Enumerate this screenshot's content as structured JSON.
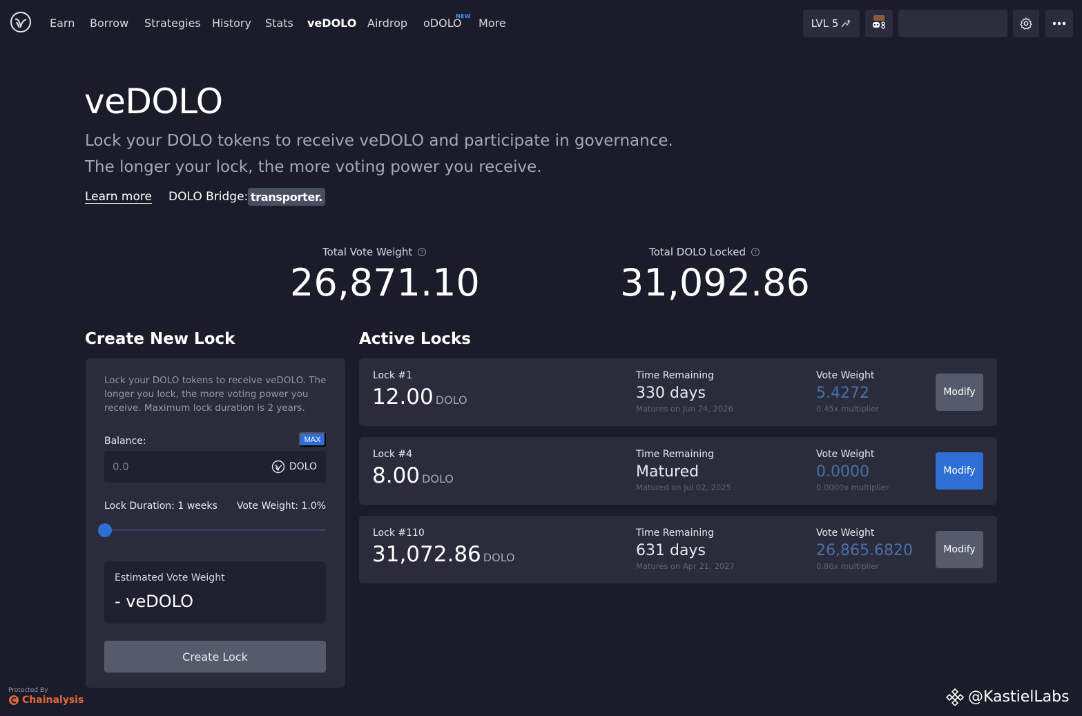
{
  "nav": {
    "items": [
      "Earn",
      "Borrow",
      "Strategies",
      "History",
      "Stats",
      "veDOLO",
      "Airdrop",
      "oDOLO",
      "More"
    ],
    "active": "veDOLO",
    "new_badge": "NEW",
    "level": "LVL 5"
  },
  "hero": {
    "title": "veDOLO",
    "subtitle_line1": "Lock your DOLO tokens to receive veDOLO and participate in governance.",
    "subtitle_line2": "The longer your lock, the more voting power you receive.",
    "learn_more": "Learn more",
    "bridge_label": "DOLO Bridge:",
    "bridge_name": "transporter."
  },
  "stats": {
    "total_vote_weight_label": "Total Vote Weight",
    "total_vote_weight": "26,871.10",
    "total_dolo_locked_label": "Total DOLO Locked",
    "total_dolo_locked": "31,092.86"
  },
  "create_lock": {
    "title": "Create New Lock",
    "description": "Lock your DOLO tokens to receive veDOLO. The longer you lock, the more voting power you receive. Maximum lock duration is 2 years.",
    "balance_label": "Balance:",
    "max_label": "MAX",
    "amount_placeholder": "0.0",
    "token": "DOLO",
    "duration_label": "Lock Duration: 1 weeks",
    "vote_weight_label": "Vote Weight: 1.0%",
    "slider_value": 0,
    "estimated_label": "Estimated Vote Weight",
    "estimated_value": "- veDOLO",
    "button": "Create Lock"
  },
  "active_locks": {
    "title": "Active Locks",
    "time_remaining_label": "Time Remaining",
    "vote_weight_label": "Vote Weight",
    "modify_label": "Modify",
    "unit": "DOLO",
    "locks": [
      {
        "name": "Lock #1",
        "amount": "12.00",
        "time": "330 days",
        "time_sub": "Matures on Jun 24, 2026",
        "weight": "5.4272",
        "multiplier": "0.45x multiplier",
        "primary": false
      },
      {
        "name": "Lock #4",
        "amount": "8.00",
        "time": "Matured",
        "time_sub": "Matured on Jul 02, 2025",
        "weight": "0.0000",
        "multiplier": "0.0000x multiplier",
        "primary": true
      },
      {
        "name": "Lock #110",
        "amount": "31,072.86",
        "time": "631 days",
        "time_sub": "Matures on Apr 21, 2027",
        "weight": "26,865.6820",
        "multiplier": "0.86x multiplier",
        "primary": false
      }
    ]
  },
  "footer": {
    "protected_by": "Protected By",
    "chainalysis": "Chainalysis",
    "watermark": "@KastielLabs"
  },
  "colors": {
    "background": "#1b1c29",
    "card": "#2a2c3c",
    "accent": "#2f6fd4",
    "weight_text": "#4b6fa8"
  },
  "icons": [
    "dolomite-logo-icon",
    "sparkle-icon",
    "avatar-icon",
    "gear-icon",
    "ellipsis-icon",
    "help-icon",
    "dolo-token-icon",
    "chainalysis-icon",
    "binance-icon"
  ]
}
